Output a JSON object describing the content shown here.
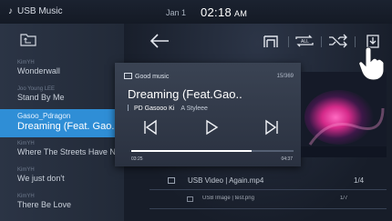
{
  "statusbar": {
    "app_title": "USB Music",
    "date": "Jan 1",
    "time": "02:18",
    "ampm": "AM"
  },
  "playlist": {
    "items": [
      {
        "artist": "KimYH",
        "title": "Wonderwall"
      },
      {
        "artist": "Joo Young LEE",
        "title": "Stand By Me"
      },
      {
        "artist": "Gasoo_Pdragon",
        "title": "Dreaming (Feat. Gao..",
        "active": true
      },
      {
        "artist": "KimYH",
        "title": "Where The Streets Have N.."
      },
      {
        "artist": "KimYH",
        "title": "We just don't"
      },
      {
        "artist": "KimYH",
        "title": "There Be Love"
      }
    ]
  },
  "now_playing": {
    "folder": "Good music",
    "count": "15/369",
    "title": "Dreaming (Feat.Gao..",
    "artist": "PD Gasooo Ki",
    "album": "A Styleee",
    "elapsed": "03:25",
    "total": "04:37",
    "progress_fraction": 0.74
  },
  "queue_rows": [
    {
      "label": "USB Video  |  Again.mp4",
      "count": "1/4"
    },
    {
      "label": "USB Image  |  test.png",
      "count": "1/7"
    }
  ],
  "icons": {
    "back": "back-arrow-icon",
    "list": "list-icon",
    "repeat": "repeat-all-icon",
    "shuffle": "shuffle-icon",
    "download": "download-icon"
  },
  "colors": {
    "accent": "#2f8ed6"
  }
}
